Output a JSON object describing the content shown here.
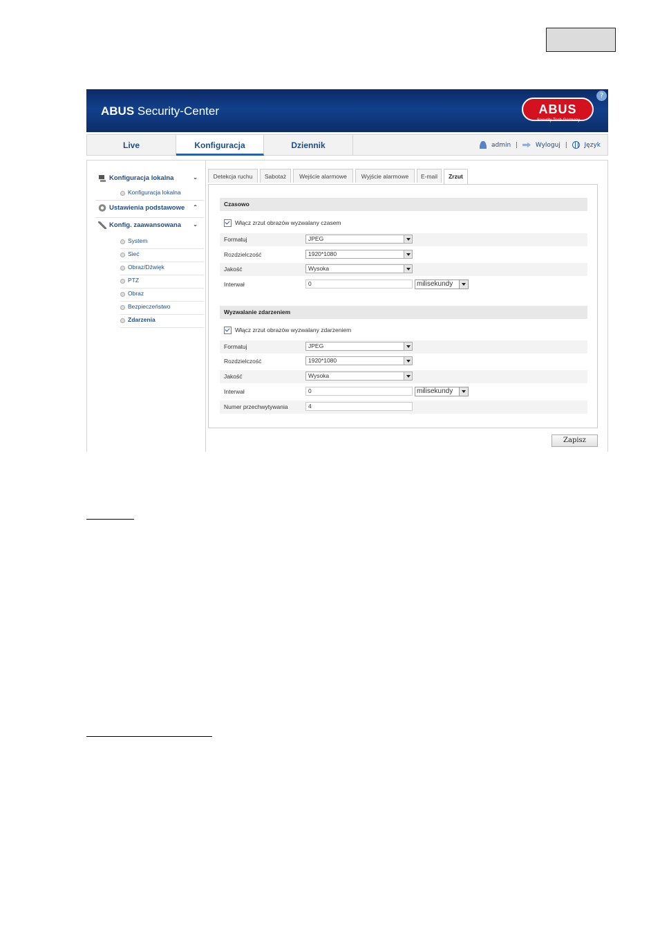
{
  "header": {
    "brand_bold": "ABUS",
    "brand_rest": " Security-Center",
    "logo_text": "ABUS",
    "logo_sub": "Security Tech Germany",
    "help_icon": "?"
  },
  "nav": {
    "tabs": [
      "Live",
      "Konfiguracja",
      "Dziennik"
    ],
    "active": "Konfiguracja",
    "user": "admin",
    "logout": "Wyloguj",
    "language": "Język",
    "separator": "|"
  },
  "sidebar": {
    "local_config": "Konfiguracja lokalna",
    "local_config_item": "Konfiguracja lokalna",
    "basic_settings": "Ustawienia podstawowe",
    "advanced": "Konfig. zaawansowana",
    "items": [
      "System",
      "Sieć",
      "Obraz/Dźwięk",
      "PTZ",
      "Obraz",
      "Bezpieczeństwo",
      "Zdarzenia"
    ],
    "active_item": "Zdarzenia"
  },
  "tabs": [
    "Detekcja ruchu",
    "Sabotaż",
    "Wejście alarmowe",
    "Wyjście alarmowe",
    "E-mail",
    "Zrzut"
  ],
  "active_tab": "Zrzut",
  "timed": {
    "title": "Czasowo",
    "enable_label": "Włącz zrzut obrazów wyzwalany czasem",
    "enabled": true,
    "format_label": "Formatuj",
    "format_value": "JPEG",
    "resolution_label": "Rozdzielczość",
    "resolution_value": "1920*1080",
    "quality_label": "Jakość",
    "quality_value": "Wysoka",
    "interval_label": "Interwał",
    "interval_value": "0",
    "interval_unit": "milisekundy"
  },
  "event": {
    "title": "Wyzwalanie zdarzeniem",
    "enable_label": "Włącz zrzut obrazów wyzwalany zdarzeniem",
    "enabled": true,
    "format_label": "Formatuj",
    "format_value": "JPEG",
    "resolution_label": "Rozdzielczość",
    "resolution_value": "1920*1080",
    "quality_label": "Jakość",
    "quality_value": "Wysoka",
    "interval_label": "Interwał",
    "interval_value": "0",
    "interval_unit": "milisekundy",
    "capture_count_label": "Numer przechwytywania",
    "capture_count_value": "4"
  },
  "save_label": "Zapisz",
  "colors": {
    "banner": "#12408c",
    "link": "#1c4c8a",
    "accent": "#2561ad",
    "logo": "#d4121f"
  }
}
